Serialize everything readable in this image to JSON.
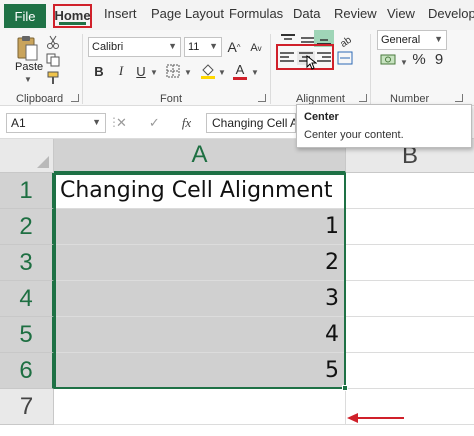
{
  "menu": {
    "tabs": [
      "File",
      "Home",
      "Insert",
      "Page Layout",
      "Formulas",
      "Data",
      "Review",
      "View",
      "Develop"
    ]
  },
  "ribbon": {
    "clipboard": {
      "paste_label": "Paste",
      "group_label": "Clipboard"
    },
    "font": {
      "font_name": "Calibri",
      "font_size": "11",
      "bold": "B",
      "italic": "I",
      "underline": "U",
      "group_label": "Font"
    },
    "alignment": {
      "group_label": "Alignment"
    },
    "number": {
      "format": "General",
      "percent": "%",
      "comma": "9",
      "group_label": "Number"
    }
  },
  "tooltip": {
    "title": "Center",
    "description": "Center your content."
  },
  "formula_bar": {
    "name_box": "A1",
    "fx": "fx",
    "content": "Changing Cell Alignment"
  },
  "sheet": {
    "columns": [
      "A",
      "B"
    ],
    "rows": [
      "1",
      "2",
      "3",
      "4",
      "5",
      "6",
      "7"
    ],
    "cells": [
      {
        "row": 1,
        "value": "Changing Cell Alignment"
      },
      {
        "row": 2,
        "value": "1"
      },
      {
        "row": 3,
        "value": "2"
      },
      {
        "row": 4,
        "value": "3"
      },
      {
        "row": 5,
        "value": "4"
      },
      {
        "row": 6,
        "value": "5"
      }
    ]
  },
  "colors": {
    "excel_green": "#1e7145",
    "highlight_red": "#d0202a",
    "selection_gray": "#d0d0d0"
  }
}
